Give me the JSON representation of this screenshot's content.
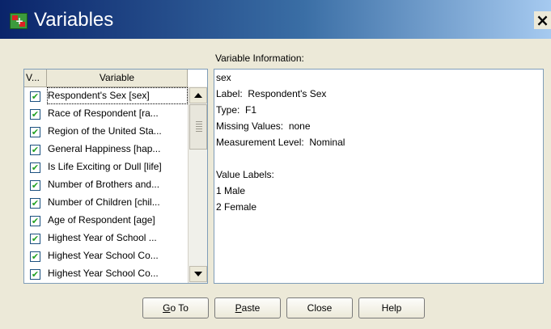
{
  "window": {
    "title": "Variables",
    "close_glyph": "×"
  },
  "info_caption": "Variable Information:",
  "list": {
    "header": {
      "v": "V...",
      "variable": "Variable"
    },
    "rows": [
      {
        "checked": true,
        "label": "Respondent's Sex [sex]",
        "selected": true
      },
      {
        "checked": true,
        "label": "Race of Respondent [ra..."
      },
      {
        "checked": true,
        "label": "Region of the United Sta..."
      },
      {
        "checked": true,
        "label": "General Happiness [hap..."
      },
      {
        "checked": true,
        "label": "Is Life Exciting or Dull [life]"
      },
      {
        "checked": true,
        "label": "Number of Brothers and..."
      },
      {
        "checked": true,
        "label": "Number of Children [chil..."
      },
      {
        "checked": true,
        "label": "Age of Respondent [age]"
      },
      {
        "checked": true,
        "label": "Highest Year of School ..."
      },
      {
        "checked": true,
        "label": "Highest Year School Co..."
      },
      {
        "checked": true,
        "label": "Highest Year School Co..."
      }
    ],
    "check_glyph": "✔"
  },
  "info": {
    "lines": [
      "sex",
      "Label:  Respondent's Sex",
      "Type:  F1",
      "Missing Values:  none",
      "Measurement Level:  Nominal",
      "",
      "Value Labels:",
      "1 Male",
      "2 Female"
    ]
  },
  "buttons": {
    "goto": {
      "mnemonic": "G",
      "rest": "o To"
    },
    "paste": {
      "mnemonic": "P",
      "rest": "aste"
    },
    "close": "Close",
    "help": "Help"
  },
  "icons": {
    "app": "spss-data-grid-icon",
    "close": "close-icon",
    "check": "checkmark-icon",
    "up": "scroll-up-arrow-icon",
    "down": "scroll-down-arrow-icon"
  },
  "colors": {
    "titlebar_start": "#0a246a",
    "titlebar_end": "#a6caf0",
    "dialog_bg": "#ece9d8",
    "check_color": "#21a121"
  }
}
